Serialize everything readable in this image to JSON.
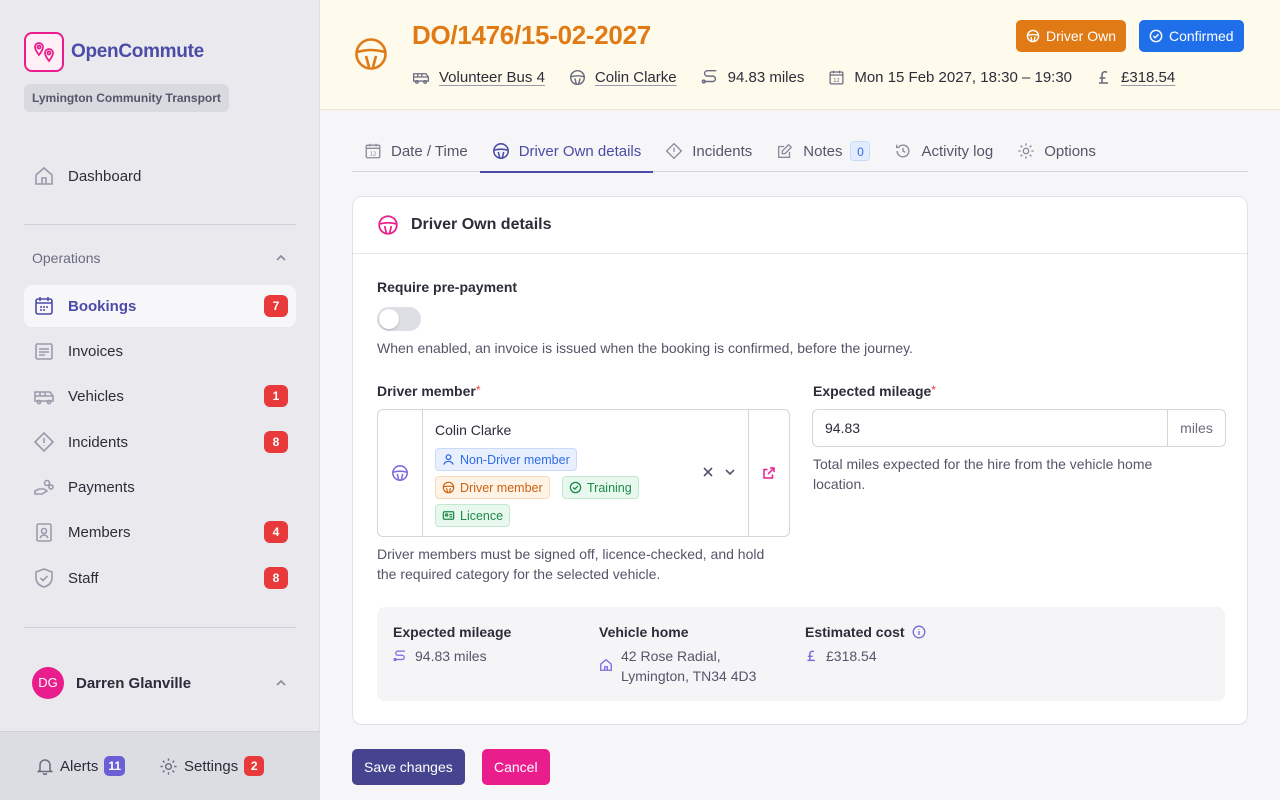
{
  "app": {
    "name": "OpenCommute",
    "org": "Lymington Community Transport"
  },
  "sidebar": {
    "dashboard": "Dashboard",
    "section": "Operations",
    "items": [
      {
        "label": "Bookings",
        "count": "7"
      },
      {
        "label": "Invoices",
        "count": ""
      },
      {
        "label": "Vehicles",
        "count": "1"
      },
      {
        "label": "Incidents",
        "count": "8"
      },
      {
        "label": "Payments",
        "count": ""
      },
      {
        "label": "Members",
        "count": "4"
      },
      {
        "label": "Staff",
        "count": "8"
      }
    ],
    "user": {
      "initials": "DG",
      "name": "Darren Glanville"
    },
    "footer": {
      "alerts_label": "Alerts",
      "alerts_count": "11",
      "settings_label": "Settings",
      "settings_count": "2"
    }
  },
  "header": {
    "ref": "DO/1476/15-02-2027",
    "vehicle": "Volunteer Bus 4",
    "driver": "Colin Clarke",
    "distance": "94.83 miles",
    "datetime": "Mon 15 Feb 2027, 18:30 – 19:30",
    "price": "£318.54",
    "type_badge": "Driver Own",
    "status_badge": "Confirmed"
  },
  "tabs": {
    "date_time": "Date / Time",
    "driver_own": "Driver Own details",
    "incidents": "Incidents",
    "notes": "Notes",
    "notes_count": "0",
    "activity": "Activity log",
    "options": "Options"
  },
  "form": {
    "title": "Driver Own details",
    "prepay_label": "Require pre-payment",
    "prepay_enabled": false,
    "prepay_help": "When enabled, an invoice is issued when the booking is confirmed, before the journey.",
    "driver_label": "Driver member",
    "driver_value": "Colin Clarke",
    "driver_tags": {
      "non_driver": "Non-Driver member",
      "driver": "Driver member",
      "training": "Training",
      "licence": "Licence"
    },
    "driver_help_1": "Driver members must be signed off, licence-checked, and hold",
    "driver_help_2": "the required category for the selected vehicle.",
    "mileage_label": "Expected mileage",
    "mileage_value": "94.83",
    "mileage_unit": "miles",
    "mileage_help_1": "Total miles expected for the hire from the vehicle home",
    "mileage_help_2": "location."
  },
  "summary": {
    "mileage_head": "Expected mileage",
    "mileage_val": "94.83 miles",
    "home_head": "Vehicle home",
    "home_line1": "42 Rose Radial,",
    "home_line2": "Lymington, TN34 4D3",
    "cost_head": "Estimated cost",
    "cost_val": "£318.54"
  },
  "actions": {
    "save": "Save changes",
    "cancel": "Cancel"
  },
  "colors": {
    "accent": "#4b4ba8",
    "brand": "#e91e8c",
    "orange": "#e07a14",
    "confirmed": "#1f6feb",
    "danger": "#e83a3a"
  }
}
